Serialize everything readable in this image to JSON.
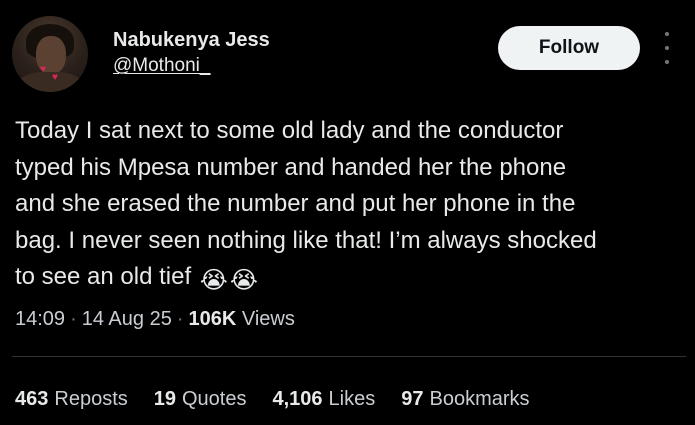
{
  "author": {
    "display_name": "Nabukenya Jess",
    "handle": "@Mothoni_"
  },
  "follow_label": "Follow",
  "tweet": {
    "lines": [
      "Today I sat next to some old lady and the conductor",
      "typed his Mpesa number and handed her the phone",
      "and she erased the number and put her phone in the",
      "bag. I never seen nothing like that! I’m always shocked",
      "to see an old tief"
    ],
    "emojis": [
      "😭",
      "😭"
    ]
  },
  "meta": {
    "time": "14:09",
    "date": "14 Aug 25",
    "views_count": "106K",
    "views_label": "Views"
  },
  "stats": [
    {
      "count": "463",
      "label": "Reposts"
    },
    {
      "count": "19",
      "label": "Quotes"
    },
    {
      "count": "4,106",
      "label": "Likes"
    },
    {
      "count": "97",
      "label": "Bookmarks"
    }
  ]
}
